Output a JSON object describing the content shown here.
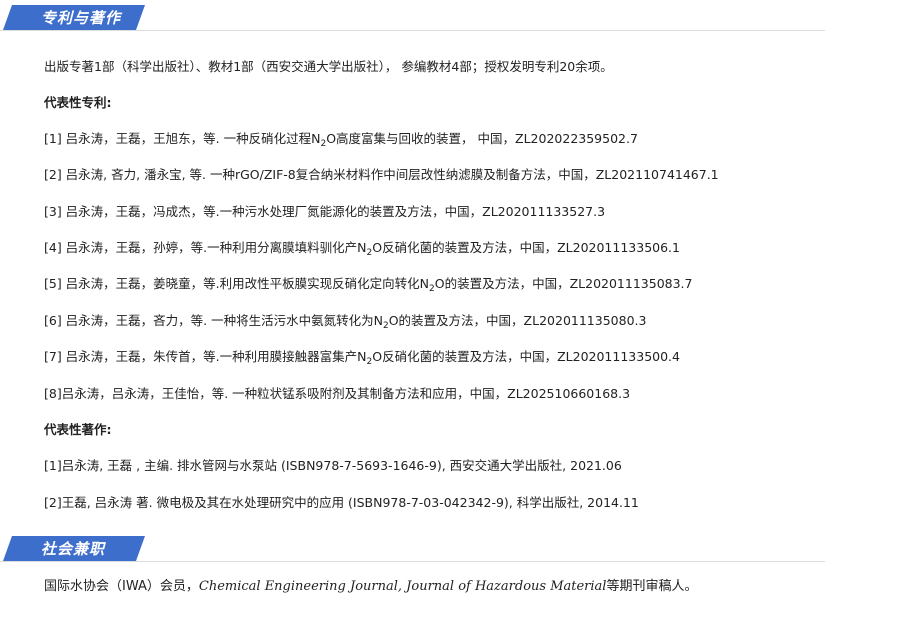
{
  "sections": {
    "patents_title": "专利与著作",
    "social_title": "社会兼职"
  },
  "summary": "出版专著1部（科学出版社）、教材1部（西安交通大学出版社）， 参编教材4部；授权发明专利20余项。",
  "patents_label": "代表性专利:",
  "patents": [
    {
      "pre": "[1] 吕永涛，王磊，王旭东，等. 一种反硝化过程N",
      "sub": "2",
      "post": "O高度富集与回收的装置， 中国，ZL202022359502.7"
    },
    {
      "pre": "[2] 吕永涛, 吝力, 潘永宝, 等. 一种rGO/ZIF-8复合纳米材料作中间层改性纳滤膜及制备方法，中国，ZL202110741467.1",
      "sub": "",
      "post": ""
    },
    {
      "pre": "[3] 吕永涛，王磊，冯成杰，等.一种污水处理厂氮能源化的装置及方法，中国，ZL202011133527.3",
      "sub": "",
      "post": ""
    },
    {
      "pre": "[4] 吕永涛，王磊，孙婷，等.一种利用分离膜填料驯化产N",
      "sub": "2",
      "post": "O反硝化菌的装置及方法，中国，ZL202011133506.1"
    },
    {
      "pre": "[5] 吕永涛，王磊，姜晓童，等.利用改性平板膜实现反硝化定向转化N",
      "sub": "2",
      "post": "O的装置及方法，中国，ZL202011135083.7"
    },
    {
      "pre": "[6] 吕永涛，王磊，吝力，等. 一种将生活污水中氨氮转化为N",
      "sub": "2",
      "post": "O的装置及方法，中国，ZL202011135080.3"
    },
    {
      "pre": "[7] 吕永涛，王磊，朱传首，等.一种利用膜接触器富集产N",
      "sub": "2",
      "post": "O反硝化菌的装置及方法，中国，ZL202011133500.4"
    },
    {
      "pre": "[8]吕永涛，吕永涛，王佳怡，等. 一种粒状锰系吸附剂及其制备方法和应用，中国，ZL202510660168.3",
      "sub": "",
      "post": ""
    }
  ],
  "works_label": "代表性著作:",
  "works": [
    "[1]吕永涛, 王磊 , 主编. 排水管网与水泵站 (ISBN978-7-5693-1646-9), 西安交通大学出版社, 2021.06",
    "[2]王磊, 吕永涛 著. 微电极及其在水处理研究中的应用 (ISBN978-7-03-042342-9), 科学出版社, 2014.11"
  ],
  "social": {
    "pre": "国际水协会（IWA）会员，",
    "journals": "Chemical Engineering Journal, Journal of Hazardous Material",
    "post": "等期刊审稿人。"
  },
  "colors": {
    "accent": "#3e6ecb",
    "divider": "#dcdcdc",
    "text": "#222222"
  }
}
